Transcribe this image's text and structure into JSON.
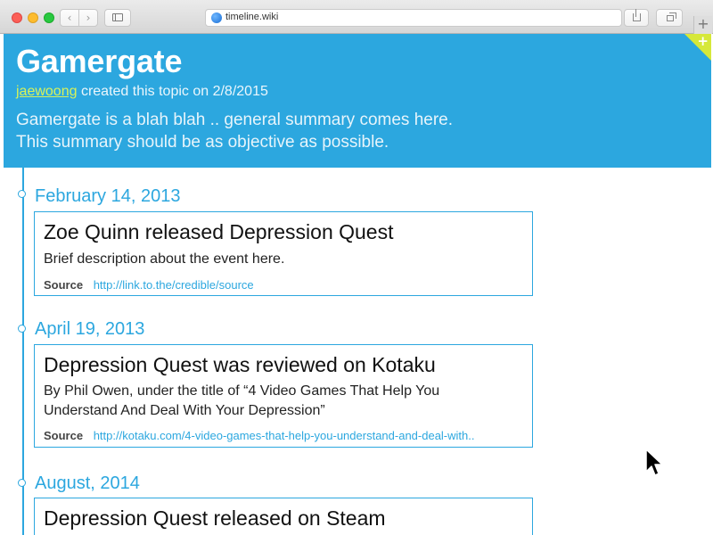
{
  "browser": {
    "url": "timeline.wiki",
    "nav_back": "‹",
    "nav_forward": "›",
    "new_tab": "+"
  },
  "header": {
    "title": "Gamergate",
    "author": "jaewoong",
    "created_text": " created this topic on 2/8/2015",
    "summary_line1": "Gamergate is a blah blah .. general summary comes here.",
    "summary_line2": "This summary should be as objective as possible.",
    "add_label": "+",
    "background_color": "#2ca7df",
    "accent_color": "#d6e83a"
  },
  "timeline": {
    "events": [
      {
        "date": "February 14, 2013",
        "title": "Zoe Quinn released Depression Quest",
        "description": "Brief description about the event here.",
        "source_label": "Source",
        "source_url": "http://link.to.the/credible/source"
      },
      {
        "date": "April 19, 2013",
        "title": "Depression Quest was reviewed on Kotaku",
        "description": "By Phil Owen, under the title of “4 Video Games That Help You Understand And Deal With Your Depression”",
        "source_label": "Source",
        "source_url": "http://kotaku.com/4-video-games-that-help-you-understand-and-deal-with.."
      },
      {
        "date": "August, 2014",
        "title": "Depression Quest released on Steam"
      }
    ]
  }
}
